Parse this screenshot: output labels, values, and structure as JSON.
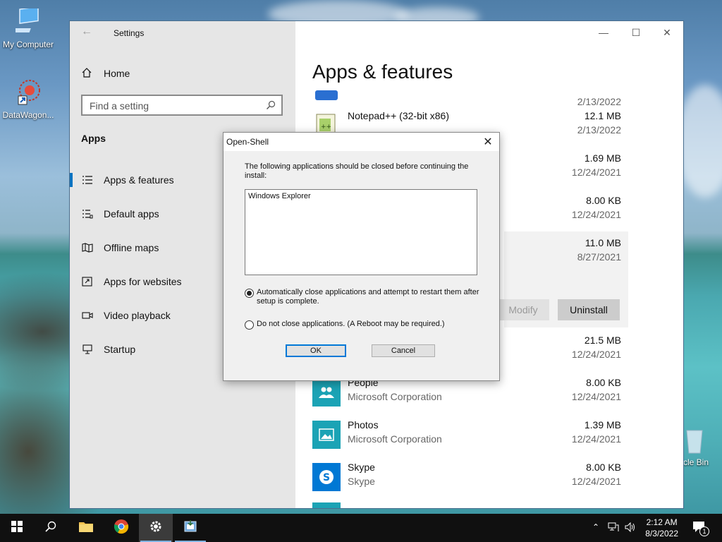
{
  "desktop": {
    "icons": [
      {
        "label": "My Computer",
        "icon": "computer-icon"
      },
      {
        "label": "DataWagon...",
        "icon": "datawagon-shortcut-icon"
      },
      {
        "label": "cle Bin",
        "icon": "recycle-bin-icon"
      }
    ]
  },
  "settings": {
    "window_title": "Settings",
    "back_icon": "back-arrow-icon",
    "home_label": "Home",
    "search_placeholder": "Find a setting",
    "section_title": "Apps",
    "nav_items": [
      {
        "label": "Apps & features",
        "icon": "apps-features-icon",
        "active": true
      },
      {
        "label": "Default apps",
        "icon": "default-apps-icon",
        "active": false
      },
      {
        "label": "Offline maps",
        "icon": "offline-maps-icon",
        "active": false
      },
      {
        "label": "Apps for websites",
        "icon": "apps-for-websites-icon",
        "active": false
      },
      {
        "label": "Video playback",
        "icon": "video-playback-icon",
        "active": false
      },
      {
        "label": "Startup",
        "icon": "startup-icon",
        "active": false
      }
    ],
    "page_title": "Apps & features",
    "apps": [
      {
        "name": "",
        "publisher": "",
        "size": "",
        "date": "2/13/2022"
      },
      {
        "name": "Notepad++ (32-bit x86)",
        "publisher": "",
        "size": "12.1 MB",
        "date": "2/13/2022"
      },
      {
        "name": "",
        "publisher": "",
        "size": "1.69 MB",
        "date": "12/24/2021"
      },
      {
        "name": "",
        "publisher": "",
        "size": "8.00 KB",
        "date": "12/24/2021"
      },
      {
        "name": "",
        "publisher": "",
        "size": "11.0 MB",
        "date": "8/27/2021"
      },
      {
        "name": "",
        "publisher": "",
        "size": "21.5 MB",
        "date": "12/24/2021"
      },
      {
        "name": "People",
        "publisher": "Microsoft Corporation",
        "size": "8.00 KB",
        "date": "12/24/2021"
      },
      {
        "name": "Photos",
        "publisher": "Microsoft Corporation",
        "size": "1.39 MB",
        "date": "12/24/2021"
      },
      {
        "name": "Skype",
        "publisher": "Skype",
        "size": "8.00 KB",
        "date": "12/24/2021"
      }
    ],
    "modify_label": "Modify",
    "uninstall_label": "Uninstall"
  },
  "dialog": {
    "title": "Open-Shell",
    "message": "The following applications should be closed before continuing the install:",
    "list_items": [
      "Windows Explorer"
    ],
    "option_auto": "Automatically close applications and attempt to restart them after setup is complete.",
    "option_no_close": "Do not close applications. (A Reboot may be required.)",
    "selected_option": "auto",
    "ok_label": "OK",
    "cancel_label": "Cancel"
  },
  "taskbar": {
    "items": [
      "start-icon",
      "search-icon",
      "file-explorer-icon",
      "chrome-icon",
      "settings-icon",
      "installer-icon"
    ],
    "time": "2:12 AM",
    "date": "8/3/2022",
    "notification_count": "1"
  },
  "colors": {
    "accent": "#0a74c2",
    "tile_teal": "#1ba3b5",
    "skype_blue": "#0078d4"
  }
}
